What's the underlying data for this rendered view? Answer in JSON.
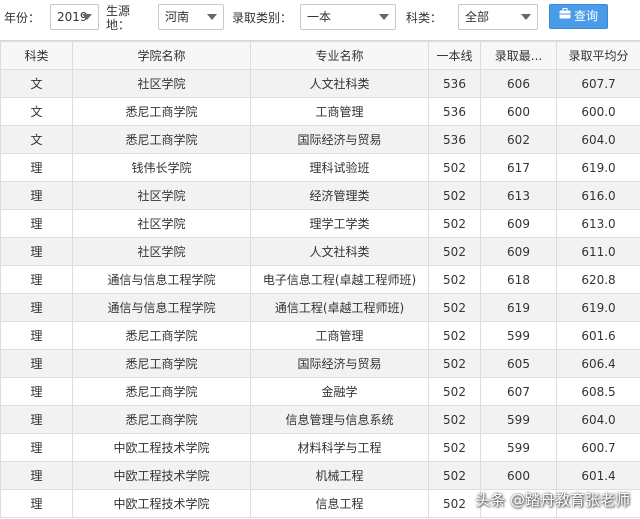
{
  "filters": {
    "year_label": "年份：",
    "year_value": "2019",
    "origin_label_line1": "生源",
    "origin_label_line2": "地：",
    "origin_value": "河南",
    "category_label": "录取类别：",
    "category_value": "一本",
    "subject_label": "科类：",
    "subject_value": "全部",
    "query_button": "查询"
  },
  "table": {
    "headers": [
      "科类",
      "学院名称",
      "专业名称",
      "一本线",
      "录取最...",
      "录取平均分"
    ],
    "rows": [
      [
        "文",
        "社区学院",
        "人文社科类",
        "536",
        "606",
        "607.7"
      ],
      [
        "文",
        "悉尼工商学院",
        "工商管理",
        "536",
        "600",
        "600.0"
      ],
      [
        "文",
        "悉尼工商学院",
        "国际经济与贸易",
        "536",
        "602",
        "604.0"
      ],
      [
        "理",
        "钱伟长学院",
        "理科试验班",
        "502",
        "617",
        "619.0"
      ],
      [
        "理",
        "社区学院",
        "经济管理类",
        "502",
        "613",
        "616.0"
      ],
      [
        "理",
        "社区学院",
        "理学工学类",
        "502",
        "609",
        "613.0"
      ],
      [
        "理",
        "社区学院",
        "人文社科类",
        "502",
        "609",
        "611.0"
      ],
      [
        "理",
        "通信与信息工程学院",
        "电子信息工程(卓越工程师班)",
        "502",
        "618",
        "620.8"
      ],
      [
        "理",
        "通信与信息工程学院",
        "通信工程(卓越工程师班)",
        "502",
        "619",
        "619.0"
      ],
      [
        "理",
        "悉尼工商学院",
        "工商管理",
        "502",
        "599",
        "601.6"
      ],
      [
        "理",
        "悉尼工商学院",
        "国际经济与贸易",
        "502",
        "605",
        "606.4"
      ],
      [
        "理",
        "悉尼工商学院",
        "金融学",
        "502",
        "607",
        "608.5"
      ],
      [
        "理",
        "悉尼工商学院",
        "信息管理与信息系统",
        "502",
        "599",
        "604.0"
      ],
      [
        "理",
        "中欧工程技术学院",
        "材料科学与工程",
        "502",
        "599",
        "600.7"
      ],
      [
        "理",
        "中欧工程技术学院",
        "机械工程",
        "502",
        "600",
        "601.4"
      ],
      [
        "理",
        "中欧工程技术学院",
        "信息工程",
        "502",
        "",
        ""
      ]
    ]
  },
  "watermark": "头条 @踏舟教育张老师",
  "colors": {
    "button": "#4a9be8",
    "row_alt": "#f2f2f2",
    "border": "#dddddd"
  }
}
